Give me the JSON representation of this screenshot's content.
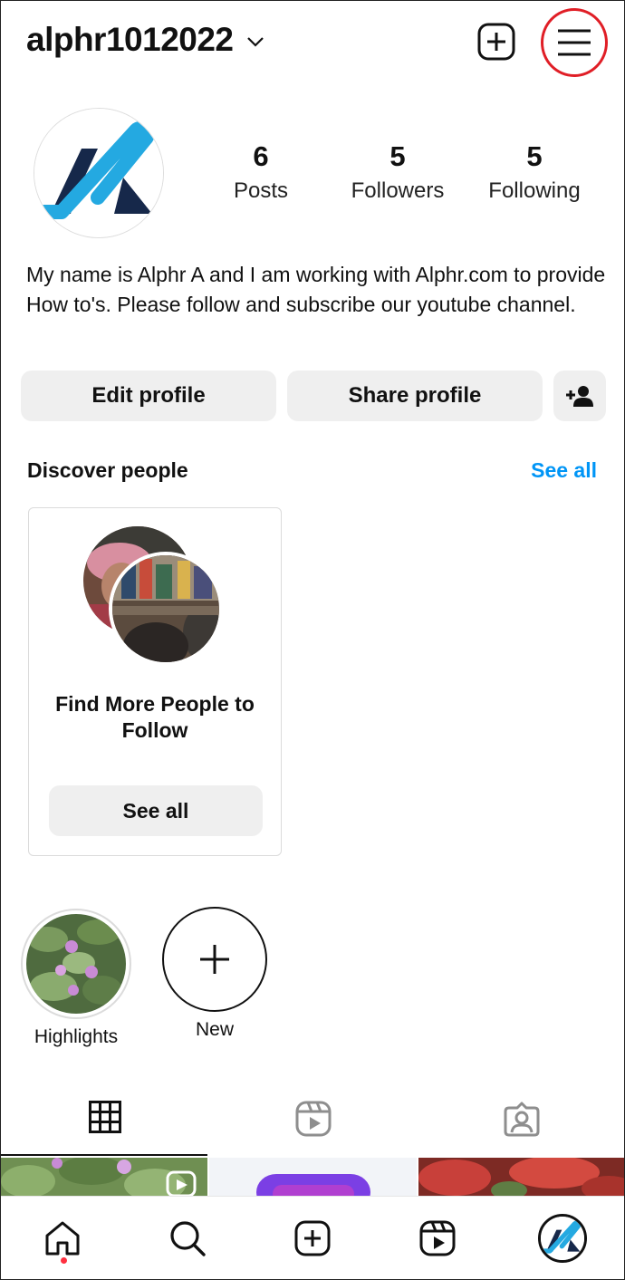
{
  "header": {
    "username": "alphr1012022"
  },
  "profile": {
    "stats": [
      {
        "value": "6",
        "label": "Posts"
      },
      {
        "value": "5",
        "label": "Followers"
      },
      {
        "value": "5",
        "label": "Following"
      }
    ],
    "bio": "My name is Alphr A and I am working with Alphr.com to provide How to's. Please follow and subscribe our youtube channel."
  },
  "actions": {
    "edit_label": "Edit profile",
    "share_label": "Share profile"
  },
  "discover": {
    "title": "Discover people",
    "see_all_link": "See all",
    "card_title": "Find More People to Follow",
    "card_button": "See all"
  },
  "highlights": [
    {
      "label": "Highlights"
    },
    {
      "label": "New"
    }
  ],
  "colors": {
    "accent": "#0095f6",
    "highlight_ring": "#e01e26",
    "notification": "#ff3040",
    "button_bg": "#efefef"
  },
  "icons": {
    "header": [
      "chevron-down-icon",
      "new-post-icon",
      "menu-icon"
    ],
    "tabs": [
      "grid-icon",
      "reels-icon",
      "tagged-icon"
    ],
    "nav": [
      "home-icon",
      "search-icon",
      "create-icon",
      "reels-icon",
      "profile-avatar"
    ]
  }
}
